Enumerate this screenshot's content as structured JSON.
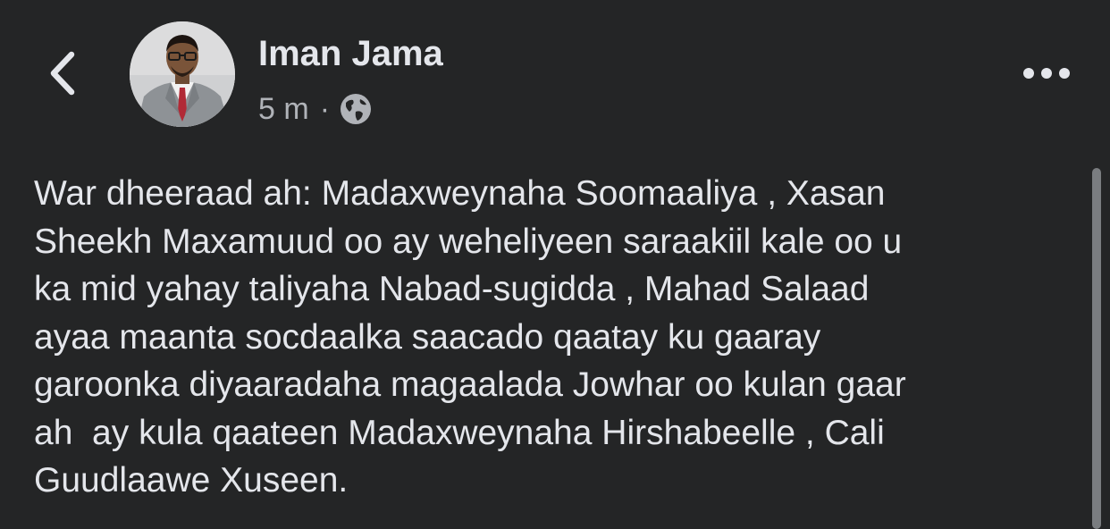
{
  "header": {
    "back_icon": "chevron-left-icon",
    "author_name": "Iman Jama",
    "timestamp": "5 m",
    "separator": "·",
    "audience_icon": "globe-icon",
    "more_icon": "more-horizontal-icon"
  },
  "post": {
    "text": "War dheeraad ah: Madaxweynaha Soomaaliya , Xasan\nSheekh Maxamuud oo ay weheliyeen saraakiil kale oo u\nka mid yahay taliyaha Nabad-sugidda , Mahad Salaad\nayaa maanta socdaalka saacado qaatay ku gaaray\ngaroonka diyaaradaha magaalada Jowhar oo kulan gaar\nah  ay kula qaateen Madaxweynaha Hirshabeelle , Cali\nGuudlaawe Xuseen."
  },
  "colors": {
    "background": "#242526",
    "primary_text": "#e4e6eb",
    "secondary_text": "#b0b3b8"
  }
}
